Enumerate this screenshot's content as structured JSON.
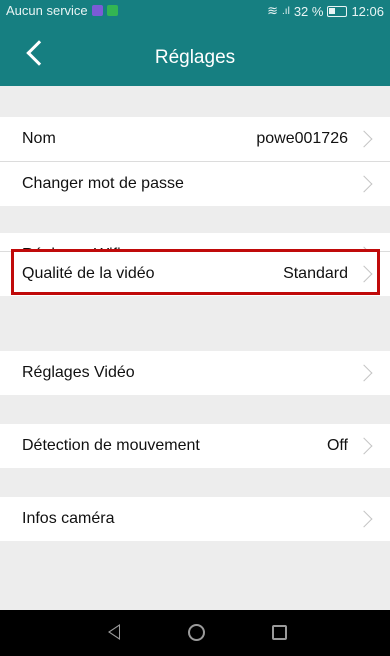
{
  "status_bar": {
    "carrier": "Aucun service",
    "battery_percent": "32 %",
    "battery_level": 0.32,
    "time": "12:06"
  },
  "header": {
    "title": "Réglages"
  },
  "settings": {
    "name_label": "Nom",
    "name_value": "powe001726",
    "password_label": "Changer mot de passe",
    "wifi_label": "Réglages Wifi",
    "quality_label": "Qualité de la vidéo",
    "quality_value": "Standard",
    "video_label": "Réglages Vidéo",
    "motion_label": "Détection de mouvement",
    "motion_value": "Off",
    "camera_label": "Infos caméra"
  },
  "colors": {
    "header": "#167f81",
    "highlight": "#c00a0a",
    "background": "#ededed"
  }
}
